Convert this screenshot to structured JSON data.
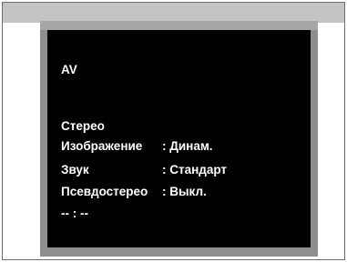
{
  "osd": {
    "source": "AV",
    "audio_mode": "Стерео",
    "rows": [
      {
        "label": "Изображение",
        "value": ": Динам."
      },
      {
        "label": "Звук",
        "value": ": Стандарт"
      },
      {
        "label": "Псевдостерео",
        "value": ": Выкл."
      }
    ],
    "clock": "-- : --"
  },
  "colors": {
    "screen_background": "#000000",
    "osd_text": "#ffffff",
    "bezel": "#8e8e8e"
  }
}
